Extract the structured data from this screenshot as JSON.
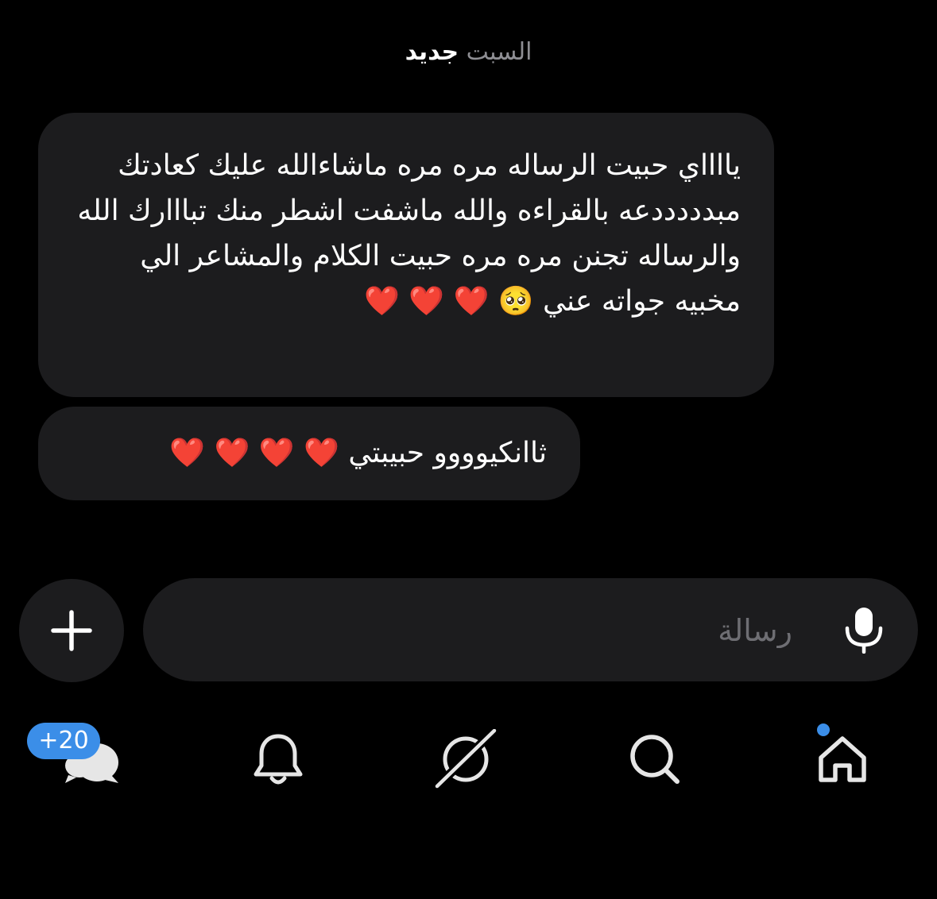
{
  "date_header": {
    "day": "السبت",
    "new": "جديد"
  },
  "messages": [
    {
      "text": "يااااي حبيت الرساله مره مره ماشاءالله عليك كعادتك مبدددددعه بالقراءه والله ماشفت اشطر منك تبااارك الله والرساله تجنن مره مره حبيت الكلام والمشاعر الي مخبيه جواته عني 🥺 ❤️ ❤️ ❤️"
    },
    {
      "text": "ثاانكيوووو حبيبتي ❤️ ❤️ ❤️ ❤️"
    }
  ],
  "composer": {
    "placeholder": "رسالة"
  },
  "nav": {
    "messages_badge": "+20"
  },
  "colors": {
    "background": "#000000",
    "bubble": "#1c1c1e",
    "accent": "#3b8ee8"
  },
  "icons": [
    "plus-icon",
    "microphone-icon",
    "chat-bubbles-icon",
    "bell-icon",
    "explore-icon",
    "search-icon",
    "home-icon"
  ]
}
